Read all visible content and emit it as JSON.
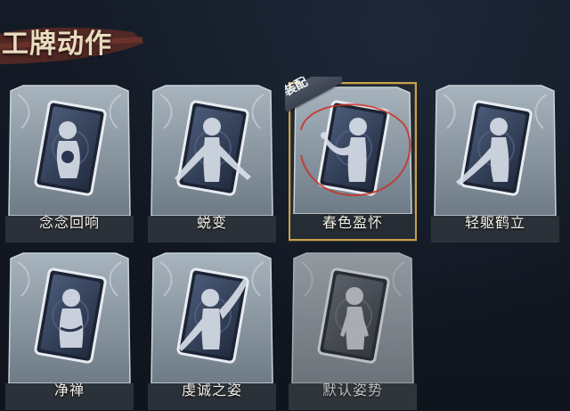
{
  "header": {
    "title": "工牌动作"
  },
  "equip_badge": "装配",
  "colors": {
    "background": "#111722",
    "card_frame": "#8e9ba6",
    "card_inner": "#33405a",
    "equipped_border": "#c9a24a",
    "selection_ring": "#c8332c",
    "label_text": "#f2efe8"
  },
  "actions": [
    {
      "label": "念念回响",
      "state": "unlocked",
      "pose": "hug-icon"
    },
    {
      "label": "蜕变",
      "state": "unlocked",
      "pose": "arms-spread-icon"
    },
    {
      "label": "春色盈怀",
      "state": "equipped",
      "pose": "flower-hold-icon"
    },
    {
      "label": "轻躯鹤立",
      "state": "unlocked",
      "pose": "crane-pose-icon"
    },
    {
      "label": "净禅",
      "state": "unlocked",
      "pose": "meditate-icon"
    },
    {
      "label": "虔诚之姿",
      "state": "unlocked",
      "pose": "raise-arm-icon"
    },
    {
      "label": "默认姿势",
      "state": "default",
      "pose": "stand-icon"
    }
  ]
}
